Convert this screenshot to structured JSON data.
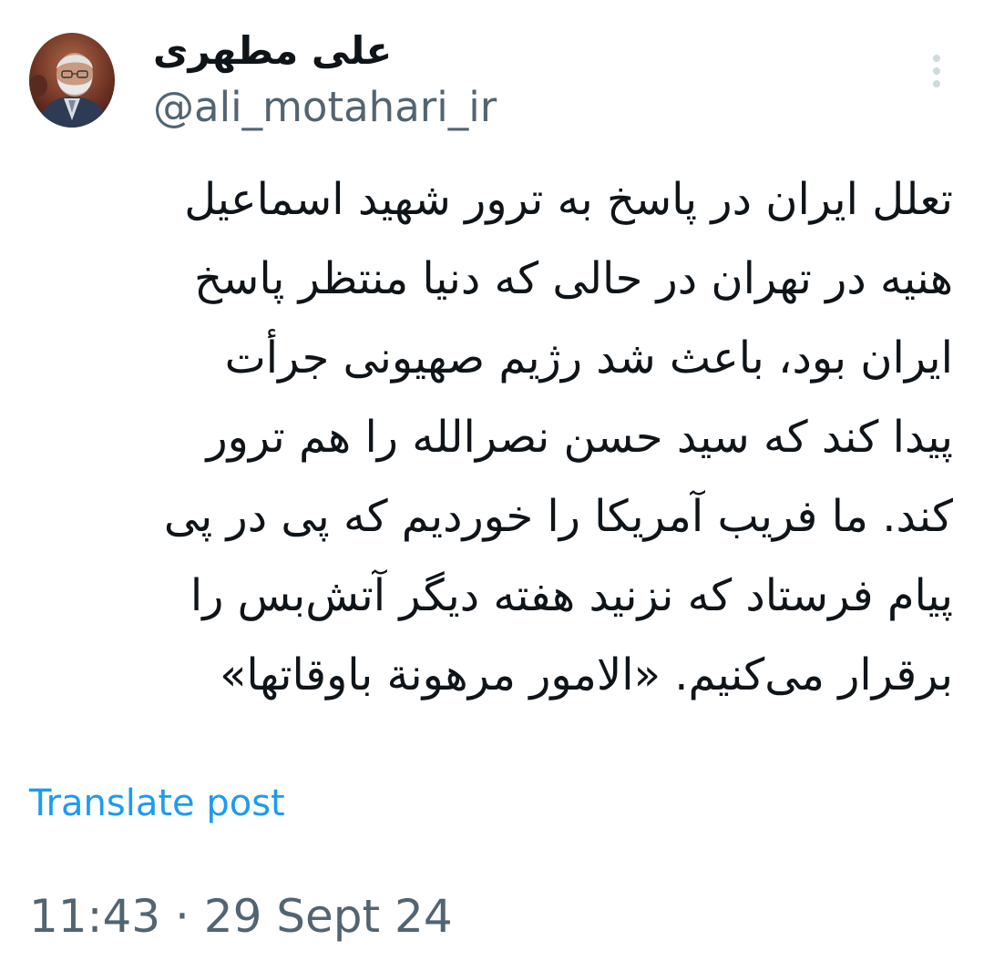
{
  "author": {
    "display_name": "علی مطهری",
    "handle": "@ali_motahari_ir",
    "avatar_icon": "profile-photo"
  },
  "menu": {
    "more_icon": "vertical-ellipsis-icon"
  },
  "tweet": {
    "lines": [
      "تعلل ایران در پاسخ به ترور شهید اسماعیل",
      "هنیه در تهران در حالی که دنیا منتظر پاسخ",
      "ایران بود، باعث شد رژیم صهیونی جرأت",
      "پیدا کند  که سید حسن نصرالله را هم ترور",
      "کند. ما فریب آمریکا را خوردیم که پی در پی",
      "پیام فرستاد که نزنید هفته دیگر آتش‌بس را",
      "برقرار می‌کنیم. «الامور مرهونة باوقاتها»"
    ]
  },
  "translate": {
    "label": "Translate post"
  },
  "meta": {
    "timestamp": "11:43 · 29 Sept 24"
  },
  "colors": {
    "text": "#0f1419",
    "secondary": "#536471",
    "link": "#1d9bf0",
    "background": "#ffffff"
  }
}
